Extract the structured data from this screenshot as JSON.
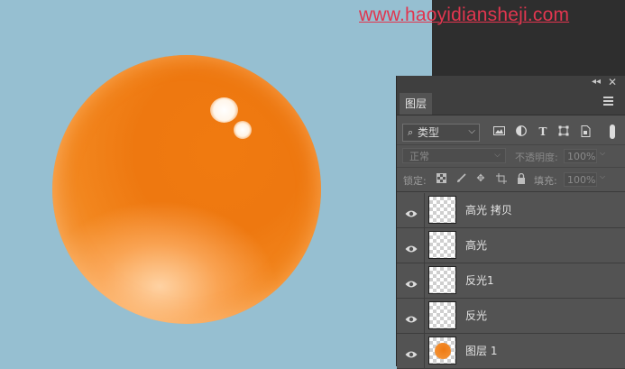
{
  "watermark": "www.haoyidiansheji.com",
  "panel": {
    "tab_label": "图层",
    "filter": {
      "kind_label": "类型"
    },
    "blend_mode": "正常",
    "opacity_label": "不透明度:",
    "opacity_value": "100%",
    "lock_label": "锁定:",
    "fill_label": "填充:",
    "fill_value": "100%"
  },
  "layers": [
    {
      "name": "高光 拷贝",
      "visible": true,
      "thumbnail": "transparent"
    },
    {
      "name": "高光",
      "visible": true,
      "thumbnail": "transparent"
    },
    {
      "name": "反光1",
      "visible": true,
      "thumbnail": "transparent"
    },
    {
      "name": "反光",
      "visible": true,
      "thumbnail": "transparent"
    },
    {
      "name": "图层 1",
      "visible": true,
      "thumbnail": "orange-sphere"
    }
  ],
  "colors": {
    "canvas_bg": "#96bfd1",
    "sphere": "#ef7a12",
    "panel_bg": "#535353",
    "watermark": "#e0364f"
  },
  "icons": [
    "search-icon",
    "chevron-down-icon",
    "image-filter-icon",
    "adjustment-filter-icon",
    "type-filter-icon",
    "shape-filter-icon",
    "smart-object-filter-icon",
    "lock-transparent-icon",
    "lock-paint-icon",
    "lock-move-icon",
    "lock-artboard-icon",
    "lock-all-icon",
    "eye-icon",
    "panel-menu-icon",
    "close-icon",
    "collapse-icon"
  ]
}
